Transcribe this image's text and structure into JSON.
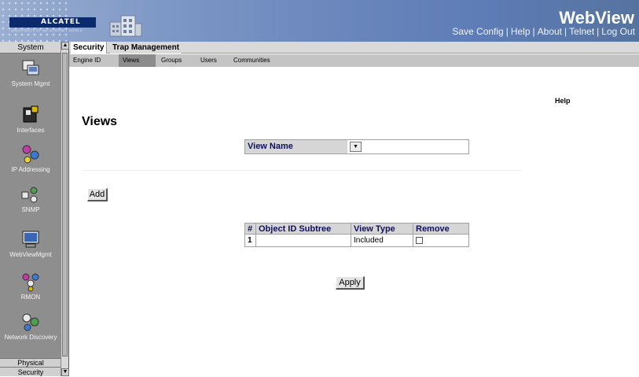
{
  "header": {
    "logo_text": "ALCATEL",
    "logo_tagline": "ARCHITECTS OF AN INTERNET WORLD",
    "title": "WebView",
    "nav": [
      "Save Config",
      "Help",
      "About",
      "Telnet",
      "Log Out"
    ],
    "nav_separator": "|"
  },
  "sidebar": {
    "header": "System",
    "items": [
      {
        "label": "System Mgmt",
        "icon": "system-mgmt-icon"
      },
      {
        "label": "Interfaces",
        "icon": "interfaces-icon"
      },
      {
        "label": "IP Addressing",
        "icon": "ip-addressing-icon"
      },
      {
        "label": "SNMP",
        "icon": "snmp-icon"
      },
      {
        "label": "WebViewMgmt",
        "icon": "webview-mgmt-icon"
      },
      {
        "label": "RMON",
        "icon": "rmon-icon"
      },
      {
        "label": "Network Discovery",
        "icon": "network-discovery-icon"
      }
    ],
    "physical_label": "Physical",
    "security_label": "Security"
  },
  "tabs": [
    {
      "label": "Security",
      "active": true
    },
    {
      "label": "Trap Management",
      "active": false
    }
  ],
  "subtabs": [
    {
      "label": "Engine ID",
      "active": false
    },
    {
      "label": "Views",
      "active": true
    },
    {
      "label": "Groups",
      "active": false
    },
    {
      "label": "Users",
      "active": false
    },
    {
      "label": "Communities",
      "active": false
    }
  ],
  "main": {
    "title": "Views",
    "help_label": "Help",
    "view_name_label": "View Name",
    "view_name_value": "",
    "add_label": "Add",
    "apply_label": "Apply",
    "table": {
      "headers": [
        "#",
        "Object ID Subtree",
        "View Type",
        "Remove"
      ],
      "rows": [
        {
          "num": "1",
          "subtree": "",
          "view_type": "Included",
          "remove": false
        }
      ]
    }
  },
  "colors": {
    "header_gradient_start": "#9aaed0",
    "header_gradient_end": "#56739f",
    "table_header_bg": "#d6d6d6",
    "table_header_text": "#101060",
    "active_subtab_bg": "#8c8c8c"
  }
}
